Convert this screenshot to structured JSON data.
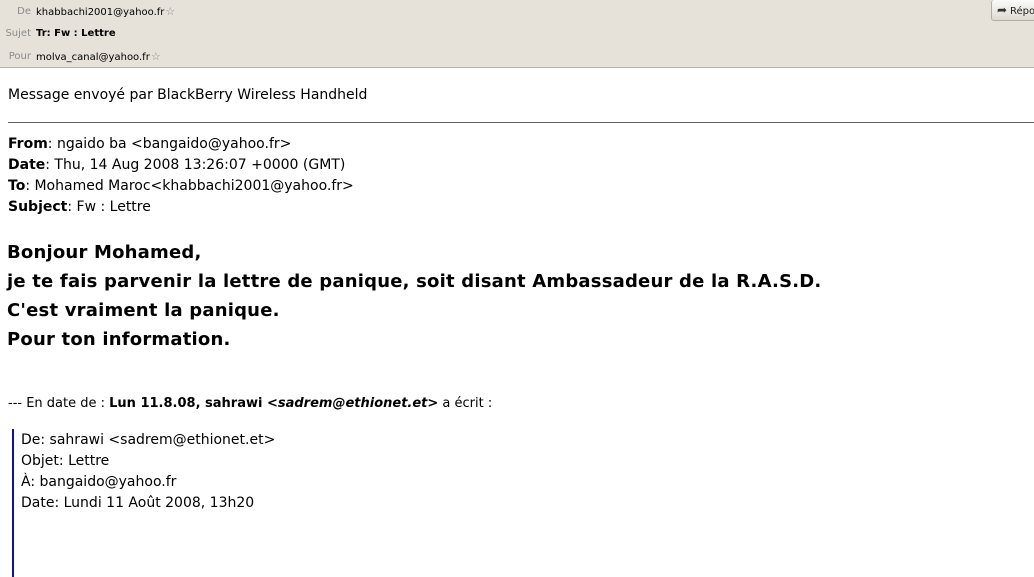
{
  "header": {
    "from_label": "De",
    "from_value": "khabbachi2001@yahoo.fr",
    "subject_label": "Sujet",
    "subject_value": "Tr: Fw : Lettre",
    "to_label": "Pour",
    "to_value": "molva_canal@yahoo.fr",
    "reply_label": "Répondre"
  },
  "body": {
    "sent_by": "Message envoyé par BlackBerry Wireless Handheld",
    "meta": {
      "from_label": "From",
      "from_value": ": ngaido ba <bangaido@yahoo.fr>",
      "date_label": "Date",
      "date_value": ": Thu, 14 Aug 2008 13:26:07 +0000 (GMT)",
      "to_label": "To",
      "to_value": ": Mohamed Maroc<khabbachi2001@yahoo.fr>",
      "subject_label": "Subject",
      "subject_value": ": Fw : Lettre"
    },
    "message_lines": [
      "Bonjour Mohamed,",
      "je te fais parvenir la lettre de panique, soit disant Ambassadeur de la R.A.S.D.",
      "C'est vraiment la panique.",
      "Pour ton information."
    ],
    "forward": {
      "prefix": "--- En date de : ",
      "date": "Lun 11.8.08, sahrawi ",
      "email": "<sadrem@ethionet.et>",
      "suffix": " a écrit :"
    },
    "quoted": [
      "De: sahrawi <sadrem@ethionet.et>",
      "Objet: Lettre",
      "À: bangaido@yahoo.fr",
      "Date: Lundi 11 Août 2008, 13h20"
    ]
  },
  "icons": {
    "star": "star-outline-icon",
    "reply": "reply-arrow-icon"
  }
}
